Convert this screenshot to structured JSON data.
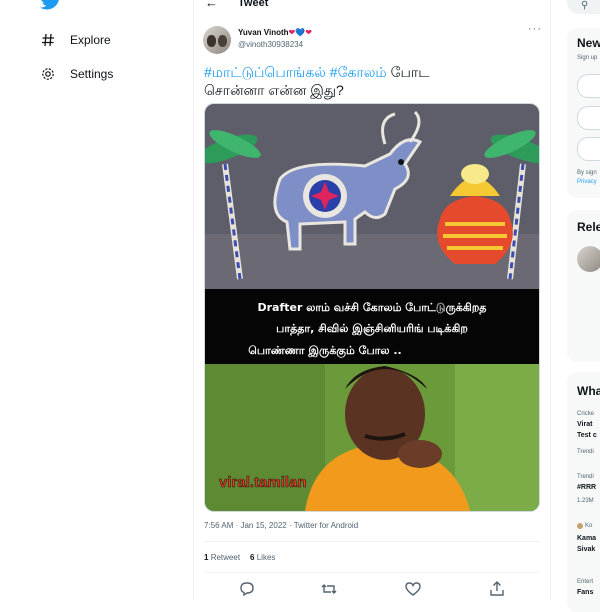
{
  "nav": {
    "items": [
      {
        "label": "Explore",
        "icon": "hashtag-icon"
      },
      {
        "label": "Settings",
        "icon": "gear-icon"
      }
    ]
  },
  "header": {
    "title": "Tweet"
  },
  "tweet": {
    "display_name": "Yuvan Vinoth",
    "name_emoji": "❤💙❤",
    "handle": "@vinoth30938234",
    "text_tag1": "#மாட்டுப்பொங்கல்",
    "text_tag2": "#கோலம்",
    "text_rest1": " போட",
    "text_line2": "சொன்னா என்ன இது?",
    "meme_line1": "Drafter லாம் வச்சி கோலம் போட்டுருக்கிறத",
    "meme_line2": "பாத்தா, சிவில் இஞ்சினியரிங் படிக்கிற",
    "meme_line3": "பொண்ணா இருக்கும் போல ..",
    "watermark": "viral.tamilan",
    "timestamp": "7:56 AM · Jan 15, 2022 · Twitter for Android",
    "retweet_count": "1",
    "retweet_label": "Retweet",
    "likes_count": "6",
    "likes_label": "Likes"
  },
  "right": {
    "new_card_title": "New",
    "signup_text": "Sign up",
    "terms_line1": "By sign",
    "terms_line2": "Privacy",
    "relevant_title": "Rele",
    "whats_title": "Wha",
    "trends": [
      {
        "cat": "Cricke",
        "line1": "Virat",
        "line2": "Test c",
        "sub": "Trendi"
      },
      {
        "cat": "Trendi",
        "line1": "#RRR",
        "line2": "",
        "sub": "1.23M"
      },
      {
        "cat": "Ko",
        "line1": "Kama",
        "line2": "Sivak",
        "sub": ""
      },
      {
        "cat": "Entert",
        "line1": "Fans",
        "line2": "",
        "sub": ""
      }
    ]
  },
  "colors": {
    "accent": "#1d9bf0",
    "heart": "#e0245e",
    "text": "#0f1419",
    "muted": "#536471"
  }
}
